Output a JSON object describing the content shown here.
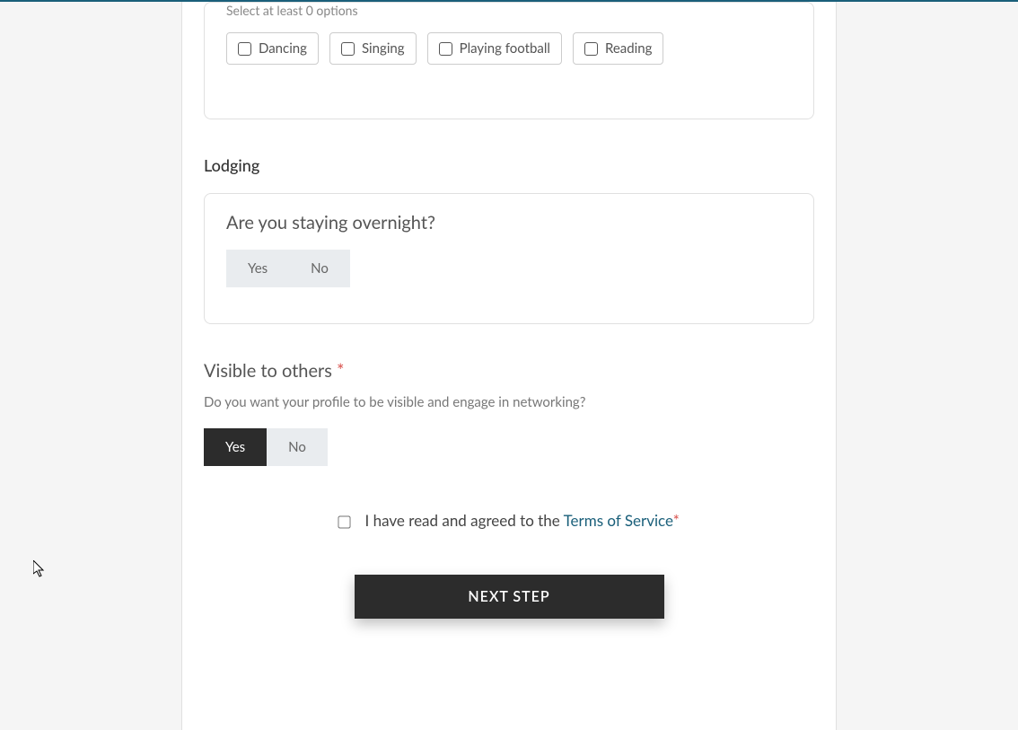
{
  "hobbies": {
    "helper": "Select at least 0 options",
    "options": [
      "Dancing",
      "Singing",
      "Playing football",
      "Reading"
    ]
  },
  "lodging": {
    "title": "Lodging",
    "question": "Are you staying overnight?",
    "yes": "Yes",
    "no": "No"
  },
  "visibility": {
    "title": "Visible to others ",
    "subtitle": "Do you want your profile to be visible and engage in networking?",
    "yes": "Yes",
    "no": "No"
  },
  "terms": {
    "prefix": " I have read and agreed to the ",
    "link": "Terms of Service"
  },
  "next_button": "NEXT STEP"
}
